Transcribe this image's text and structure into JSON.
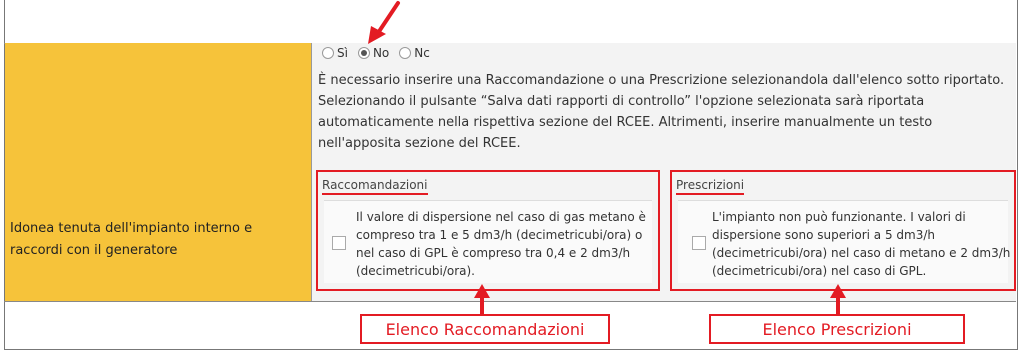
{
  "form": {
    "field_label_line1": "Idonea tenuta dell'impianto interno e",
    "field_label_line2": "raccordi con il generatore",
    "options": [
      "Sì",
      "No",
      "Nc"
    ],
    "selected_option": "No",
    "info_lines": [
      "È necessario inserire una Raccomandazione o una Prescrizione selezionandola dall'elenco sotto riportato.",
      "Selezionando il pulsante “Salva dati rapporti di controllo” l'opzione selezionata sarà riportata",
      "automaticamente nella rispettiva sezione del RCEE. Altrimenti, inserire manualmente un testo",
      "nell'apposita sezione del RCEE."
    ]
  },
  "raccomandazioni": {
    "title": "Raccomandazioni",
    "item_lines": [
      "Il valore di dispersione nel caso di gas metano è",
      "compreso tra 1 e 5 dm3/h (decimetricubi/ora) o",
      "nel caso di GPL è compreso tra 0,4 e 2 dm3/h",
      "(decimetricubi/ora)."
    ]
  },
  "prescrizioni": {
    "title": "Prescrizioni",
    "item_lines": [
      "L'impianto non può funzionante. I valori di",
      "dispersione  sono superiori a 5 dm3/h",
      "(decimetricubi/ora)  nel caso di metano e 2 dm3/h",
      "(decimetricubi/ora)  nel caso di GPL."
    ]
  },
  "annotations": {
    "callout_raccomandazioni": "Elenco Raccomandazioni",
    "callout_prescrizioni": "Elenco Prescrizioni",
    "accent_color": "#e31b23"
  }
}
